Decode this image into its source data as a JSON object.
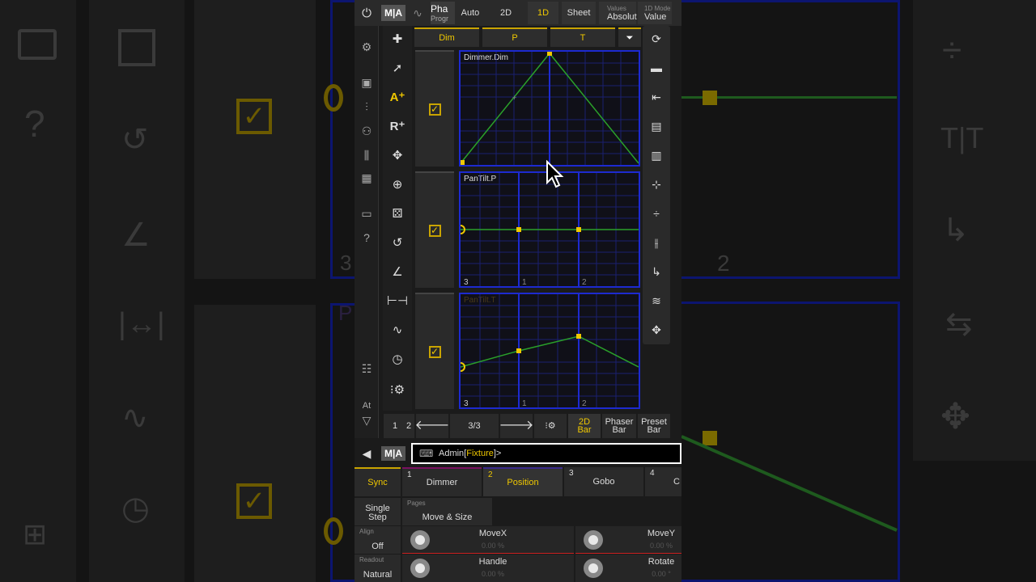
{
  "topbar": {
    "logo": "M|A",
    "phaser_label": "Pha",
    "phaser_sub": "Progr",
    "auto": "Auto",
    "two_d": "2D",
    "one_d": "1D",
    "sheet": "Sheet",
    "values_label": "Values",
    "values_value": "Absolut",
    "mode_label": "1D Mode",
    "mode_value": "Value"
  },
  "tabs": [
    "Dim",
    "P",
    "T"
  ],
  "graphs": [
    {
      "label": "Dimmer.Dim",
      "nums": [
        "",
        "",
        ""
      ]
    },
    {
      "label": "PanTilt.P",
      "nums": [
        "3",
        "1",
        "2"
      ]
    },
    {
      "label": "PanTilt.T",
      "nums": [
        "3",
        "1",
        "2"
      ]
    }
  ],
  "leftbar": {
    "at": "At"
  },
  "bottomnav": {
    "one": "1",
    "two": "2",
    "page": "3/3",
    "bar2d_a": "2D",
    "bar2d_b": "Bar",
    "phaser_a": "Phaser",
    "phaser_b": "Bar",
    "preset_a": "Preset",
    "preset_b": "Bar"
  },
  "command": {
    "logo": "M|A",
    "prefix": "Admin",
    "bracket_open": "[",
    "fixture": "Fixture",
    "bracket_close": "]>"
  },
  "features": {
    "sync": "Sync",
    "items": [
      {
        "num": "1",
        "label": "Dimmer"
      },
      {
        "num": "2",
        "label": "Position"
      },
      {
        "num": "3",
        "label": "Gobo"
      },
      {
        "num": "4",
        "label": "C"
      }
    ]
  },
  "pages": {
    "single_a": "Single",
    "single_b": "Step",
    "title": "Pages",
    "value": "Move & Size"
  },
  "align": {
    "title": "Align",
    "value": "Off"
  },
  "readout": {
    "title": "Readout",
    "value": "Natural"
  },
  "encoders": [
    {
      "name": "MoveX",
      "value": "0.00 %"
    },
    {
      "name": "MoveY",
      "value": "0.00 %"
    },
    {
      "name": "Handle",
      "value": "0.00 %"
    },
    {
      "name": "Rotate",
      "value": "0.00 °"
    }
  ],
  "background_ghost": {
    "right_num": "2",
    "left_num": "3",
    "left_p": "P"
  },
  "colors": {
    "accent": "#f0c800",
    "grid": "#1d2ad0",
    "line": "#2aa02a",
    "alert": "#c22"
  }
}
